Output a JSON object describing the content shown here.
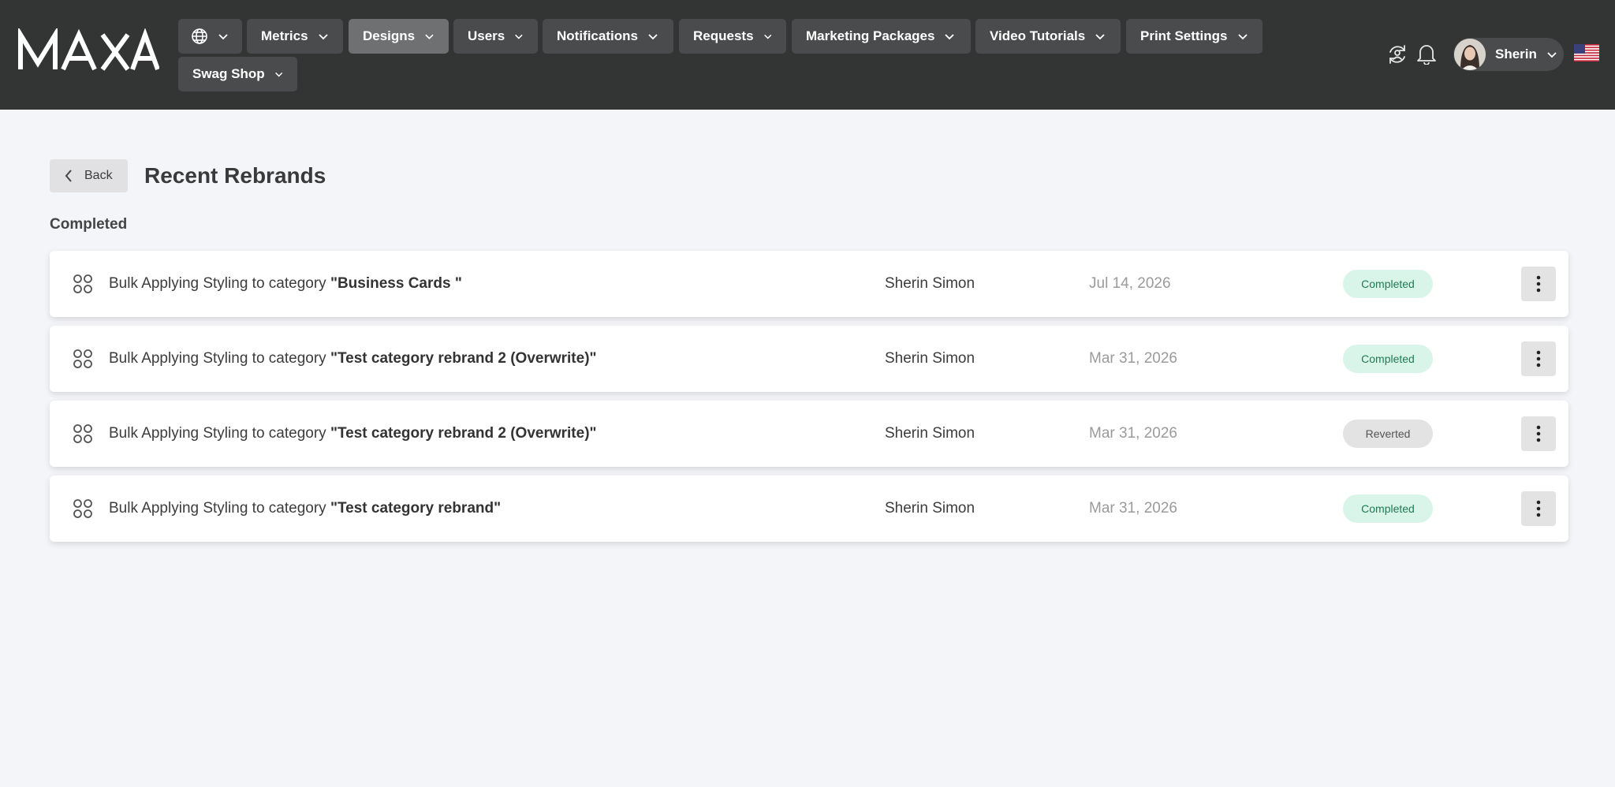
{
  "header": {
    "logo_text": "MAXA",
    "nav": [
      {
        "label": "Metrics"
      },
      {
        "label": "Designs"
      },
      {
        "label": "Users"
      },
      {
        "label": "Notifications"
      },
      {
        "label": "Requests"
      },
      {
        "label": "Marketing Packages"
      },
      {
        "label": "Video Tutorials"
      },
      {
        "label": "Print Settings"
      },
      {
        "label": "Swag Shop"
      }
    ],
    "active_nav": "Designs",
    "user_name": "Sherin",
    "icons": [
      "globe-icon",
      "sync-icon",
      "bell-icon",
      "us-flag-icon"
    ]
  },
  "page": {
    "back_label": "Back",
    "title": "Recent Rebrands",
    "section_label": "Completed"
  },
  "rows": [
    {
      "prefix": "Bulk Applying Styling to category ",
      "category": "\"Business Cards \"",
      "user": "Sherin Simon",
      "date": "Jul 14, 2026",
      "status": "Completed"
    },
    {
      "prefix": "Bulk Applying Styling to category ",
      "category": "\"Test category rebrand 2 (Overwrite)\"",
      "user": "Sherin Simon",
      "date": "Mar 31, 2026",
      "status": "Completed"
    },
    {
      "prefix": "Bulk Applying Styling to category ",
      "category": "\"Test category rebrand 2 (Overwrite)\"",
      "user": "Sherin Simon",
      "date": "Mar 31, 2026",
      "status": "Reverted"
    },
    {
      "prefix": "Bulk Applying Styling to category ",
      "category": "\"Test category rebrand\"",
      "user": "Sherin Simon",
      "date": "Mar 31, 2026",
      "status": "Completed"
    }
  ],
  "colors": {
    "header_bg": "#333434",
    "nav_button_bg": "#4a4b4c",
    "nav_active_bg": "#6f7071",
    "page_bg": "#f4f5f9",
    "completed_badge_bg": "#d9f5e9",
    "completed_badge_text": "#1f7a55",
    "reverted_badge_bg": "#e3e3e3"
  }
}
